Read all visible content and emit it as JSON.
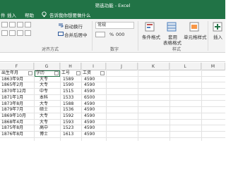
{
  "window": {
    "title": "筛选功能 - Excel"
  },
  "menu": {
    "items": [
      "件",
      "插入",
      "帮助"
    ],
    "tell_me": "告诉我你想要做什么"
  },
  "ribbon": {
    "wrap_text": "自动换行",
    "merge_center": "合并后居中",
    "number_format": "常规",
    "percent": "%",
    "thousands": "000",
    "cond_format": "条件格式",
    "table_format_1": "套用",
    "table_format_2": "表格格式",
    "cell_styles": "单元格样式",
    "insert": "插入",
    "groups": {
      "alignment": "对齐方式",
      "number": "数字",
      "styles": "样式"
    }
  },
  "sheet": {
    "columns": [
      "F",
      "G",
      "H",
      "I",
      "J",
      "K",
      "L",
      "M"
    ],
    "headers": {
      "birth": "出生年月",
      "edu": "学历",
      "id": "工号",
      "wage": "工资"
    },
    "rows": [
      {
        "birth": "1863年9月",
        "edu": "大专",
        "id": "1589",
        "wage": "4590"
      },
      {
        "birth": "1865年2月",
        "edu": "大专",
        "id": "1590",
        "wage": "4590"
      },
      {
        "birth": "1870年12月",
        "edu": "中专",
        "id": "1515",
        "wage": "4590"
      },
      {
        "birth": "1871年1月",
        "edu": "本科",
        "id": "1533",
        "wage": "6500"
      },
      {
        "birth": "1873年8月",
        "edu": "大专",
        "id": "1588",
        "wage": "4590"
      },
      {
        "birth": "1879年7月",
        "edu": "硕士",
        "id": "1536",
        "wage": "4590"
      },
      {
        "birth": "1869年10月",
        "edu": "大专",
        "id": "1592",
        "wage": "4590"
      },
      {
        "birth": "1868年4月",
        "edu": "大专",
        "id": "1593",
        "wage": "4590"
      },
      {
        "birth": "1875年8月",
        "edu": "高中",
        "id": "1523",
        "wage": "4590"
      },
      {
        "birth": "1876年8月",
        "edu": "博士",
        "id": "1613",
        "wage": "4590"
      }
    ]
  }
}
